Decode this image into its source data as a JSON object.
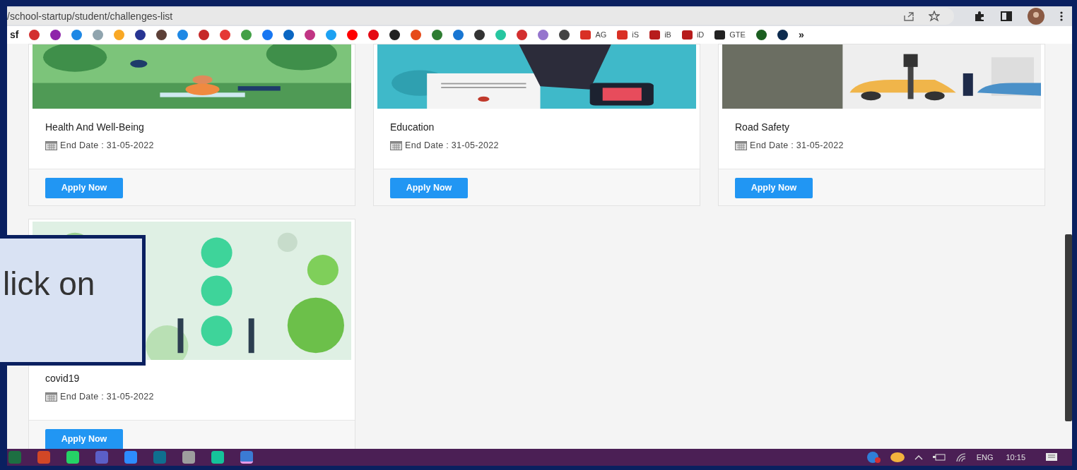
{
  "browser": {
    "url": "/school-startup/student/challenges-list"
  },
  "bookmarks": [
    {
      "kind": "text",
      "label": "sf"
    },
    {
      "kind": "icon",
      "color": "#d32f2f"
    },
    {
      "kind": "icon",
      "color": "#8e24aa"
    },
    {
      "kind": "icon",
      "color": "#1e88e5"
    },
    {
      "kind": "icon",
      "color": "#90a4ae"
    },
    {
      "kind": "icon",
      "color": "#f9a825"
    },
    {
      "kind": "icon",
      "color": "#283593"
    },
    {
      "kind": "icon",
      "color": "#5d4037"
    },
    {
      "kind": "icon",
      "color": "#1e88e5"
    },
    {
      "kind": "icon",
      "color": "#c62828"
    },
    {
      "kind": "icon",
      "color": "#e53935"
    },
    {
      "kind": "icon",
      "color": "#43a047"
    },
    {
      "kind": "icon",
      "color": "#1877f2"
    },
    {
      "kind": "icon",
      "color": "#0a66c2"
    },
    {
      "kind": "icon",
      "color": "#c13584"
    },
    {
      "kind": "icon",
      "color": "#1da1f2"
    },
    {
      "kind": "icon",
      "color": "#ff0000"
    },
    {
      "kind": "icon",
      "color": "#e50914"
    },
    {
      "kind": "icon",
      "color": "#222222"
    },
    {
      "kind": "icon",
      "color": "#e64a19"
    },
    {
      "kind": "icon",
      "color": "#2e7d32"
    },
    {
      "kind": "icon",
      "color": "#1976d2"
    },
    {
      "kind": "icon",
      "color": "#333333"
    },
    {
      "kind": "icon",
      "color": "#26c6a0"
    },
    {
      "kind": "icon",
      "color": "#d32f2f"
    },
    {
      "kind": "icon",
      "color": "#9575cd"
    },
    {
      "kind": "icon",
      "color": "#444444"
    },
    {
      "kind": "icon_label",
      "color": "#d93025",
      "label": "AG"
    },
    {
      "kind": "icon_label",
      "color": "#d93025",
      "label": "iS"
    },
    {
      "kind": "icon_label",
      "color": "#b71c1c",
      "label": "iB"
    },
    {
      "kind": "icon_label",
      "color": "#b71c1c",
      "label": "iD"
    },
    {
      "kind": "icon_label",
      "color": "#222222",
      "label": "GTE"
    },
    {
      "kind": "icon",
      "color": "#1b5e20"
    },
    {
      "kind": "icon",
      "color": "#0d2b4e"
    },
    {
      "kind": "text",
      "label": "»"
    }
  ],
  "challenges": [
    {
      "title": "Health And Well-Being",
      "end_date": "End Date : 31-05-2022",
      "button": "Apply Now"
    },
    {
      "title": "Education",
      "end_date": "End Date : 31-05-2022",
      "button": "Apply Now"
    },
    {
      "title": "Road Safety",
      "end_date": "End Date : 31-05-2022",
      "button": "Apply Now"
    },
    {
      "title": "covid19",
      "end_date": "End Date : 31-05-2022",
      "button": "Apply Now"
    }
  ],
  "callout": {
    "text": "lick on"
  },
  "taskbar": {
    "apps": [
      {
        "color": "#1d6f42",
        "selected": false
      },
      {
        "color": "#d24726",
        "selected": false
      },
      {
        "color": "#25d366",
        "selected": false
      },
      {
        "color": "#5b5fc7",
        "selected": false
      },
      {
        "color": "#2d8cff",
        "selected": false
      },
      {
        "color": "#0f6f8f",
        "selected": false
      },
      {
        "color": "#9e9e9e",
        "selected": false
      },
      {
        "color": "#15c39a",
        "selected": false
      },
      {
        "color": "#3b7bd4",
        "selected": true
      }
    ],
    "language": "ENG",
    "time": "10:15"
  }
}
